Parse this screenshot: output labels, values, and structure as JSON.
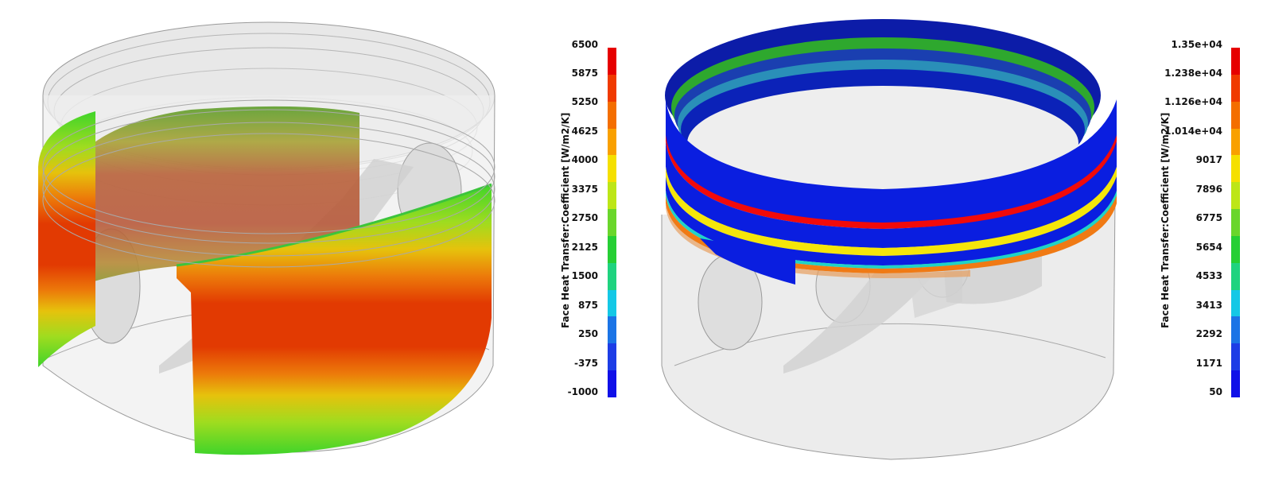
{
  "views": [
    {
      "id": "left",
      "legend": {
        "title": "Face Heat Transfer:Coefficient [W/m2/K]",
        "ticks": [
          "6500",
          "5875",
          "5250",
          "4625",
          "4000",
          "3375",
          "2750",
          "2125",
          "1500",
          "875",
          "250",
          "-375",
          "-1000"
        ]
      }
    },
    {
      "id": "right",
      "legend": {
        "title": "Face Heat Transfer:Coefficient [W/m2/K]",
        "ticks": [
          "1.35e+04",
          "1.238e+04",
          "1.126e+04",
          "1.014e+04",
          "9017",
          "7896",
          "6775",
          "5654",
          "4533",
          "3413",
          "2292",
          "1171",
          "50"
        ]
      }
    }
  ],
  "colormap": [
    "#e60000",
    "#f03a00",
    "#f46e00",
    "#f9a000",
    "#f5e000",
    "#bde617",
    "#6ad62b",
    "#26cf34",
    "#1fd37f",
    "#14c8e6",
    "#1b74e6",
    "#1d3de6",
    "#1010e8"
  ],
  "colors": {
    "piston_ghost": "#d9d9d9",
    "piston_edge": "#8a8a8a",
    "ring_blue": "#0a1ee0",
    "ring_red": "#f20a0a",
    "ring_yellow": "#f5e60a",
    "ring_green": "#2ea82e",
    "ring_orange": "#f07a14"
  }
}
